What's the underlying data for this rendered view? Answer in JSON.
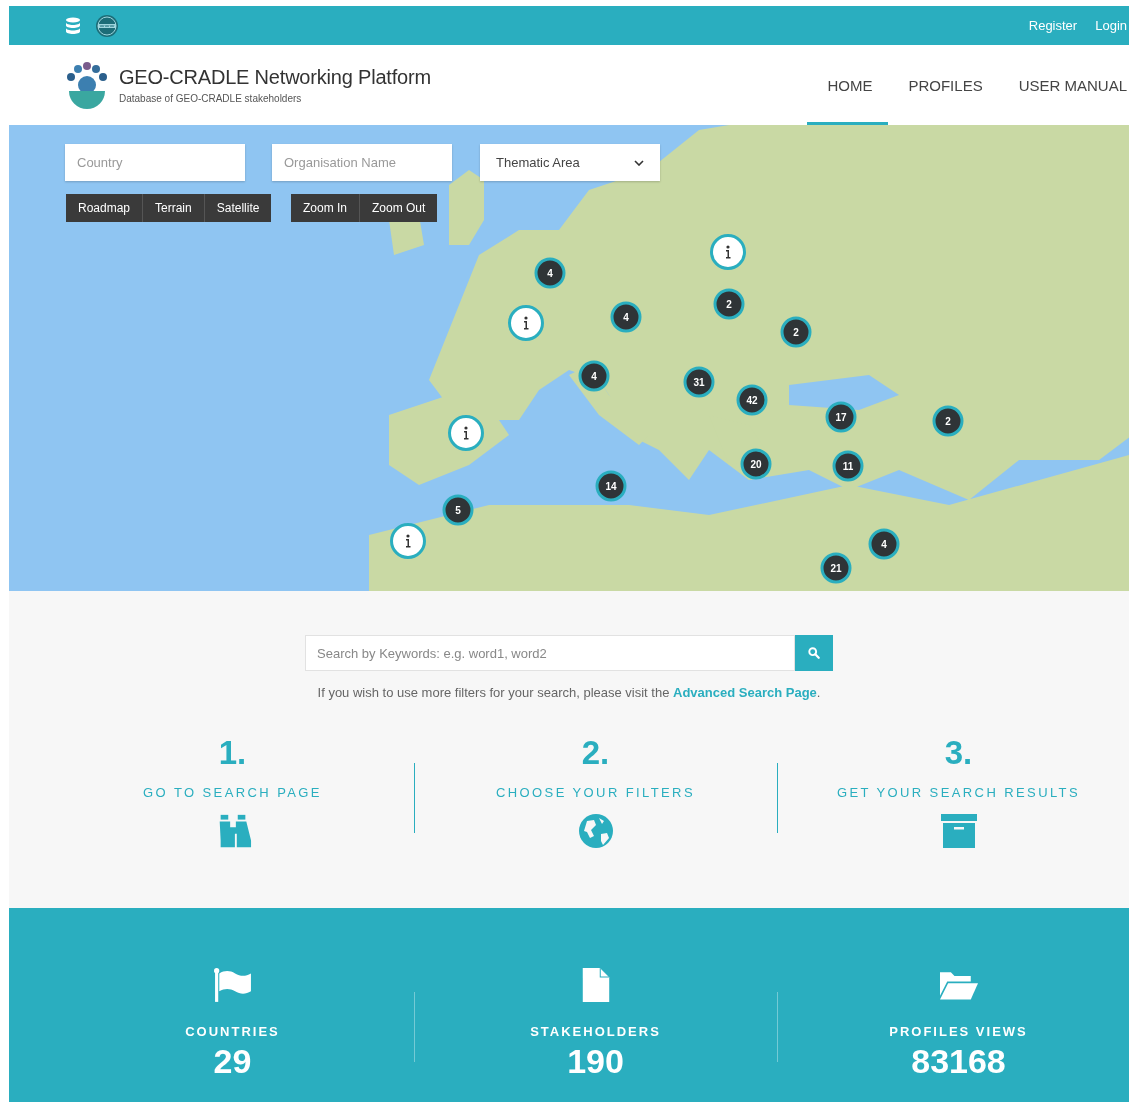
{
  "top_bar": {
    "links": [
      "Register",
      "Login"
    ]
  },
  "header": {
    "title": "GEO-CRADLE Networking Platform",
    "subtitle": "Database of GEO-CRADLE stakeholders",
    "nav": [
      {
        "label": "HOME",
        "selected": true
      },
      {
        "label": "PROFILES",
        "selected": false
      },
      {
        "label": "USER MANUAL",
        "selected": false
      }
    ]
  },
  "map": {
    "filters": [
      {
        "kind": "text",
        "placeholder": "Country"
      },
      {
        "kind": "text",
        "placeholder": "Organisation Name"
      },
      {
        "kind": "select",
        "value": "Thematic Area"
      }
    ],
    "map_type_buttons": [
      "Roadmap",
      "Terrain",
      "Satellite"
    ],
    "zoom_buttons": [
      "Zoom In",
      "Zoom Out"
    ],
    "markers": [
      {
        "kind": "cluster",
        "count": "4"
      },
      {
        "kind": "cluster",
        "count": "2"
      },
      {
        "kind": "cluster",
        "count": "4"
      },
      {
        "kind": "cluster",
        "count": "2"
      },
      {
        "kind": "cluster",
        "count": "4"
      },
      {
        "kind": "cluster",
        "count": "31"
      },
      {
        "kind": "cluster",
        "count": "42"
      },
      {
        "kind": "cluster",
        "count": "17"
      },
      {
        "kind": "cluster",
        "count": "2"
      },
      {
        "kind": "cluster",
        "count": "20"
      },
      {
        "kind": "cluster",
        "count": "11"
      },
      {
        "kind": "cluster",
        "count": "14"
      },
      {
        "kind": "cluster",
        "count": "5"
      },
      {
        "kind": "cluster",
        "count": "4"
      },
      {
        "kind": "cluster",
        "count": "21"
      },
      {
        "kind": "info"
      },
      {
        "kind": "info"
      },
      {
        "kind": "info"
      },
      {
        "kind": "info"
      }
    ]
  },
  "search": {
    "placeholder": "Search by Keywords: e.g. word1, word2",
    "hint": "If you wish to use more filters for your search, please visit the",
    "link": "Advanced Search Page",
    "hint_end": "."
  },
  "steps": [
    {
      "number": "1.",
      "label": "GO TO SEARCH PAGE"
    },
    {
      "number": "2.",
      "label": "CHOOSE YOUR FILTERS"
    },
    {
      "number": "3.",
      "label": "GET YOUR SEARCH RESULTS"
    }
  ],
  "stats": [
    {
      "label": "COUNTRIES",
      "value": "29"
    },
    {
      "label": "STAKEHOLDERS",
      "value": "190"
    },
    {
      "label": "PROFILES VIEWS",
      "value": "83168"
    }
  ]
}
